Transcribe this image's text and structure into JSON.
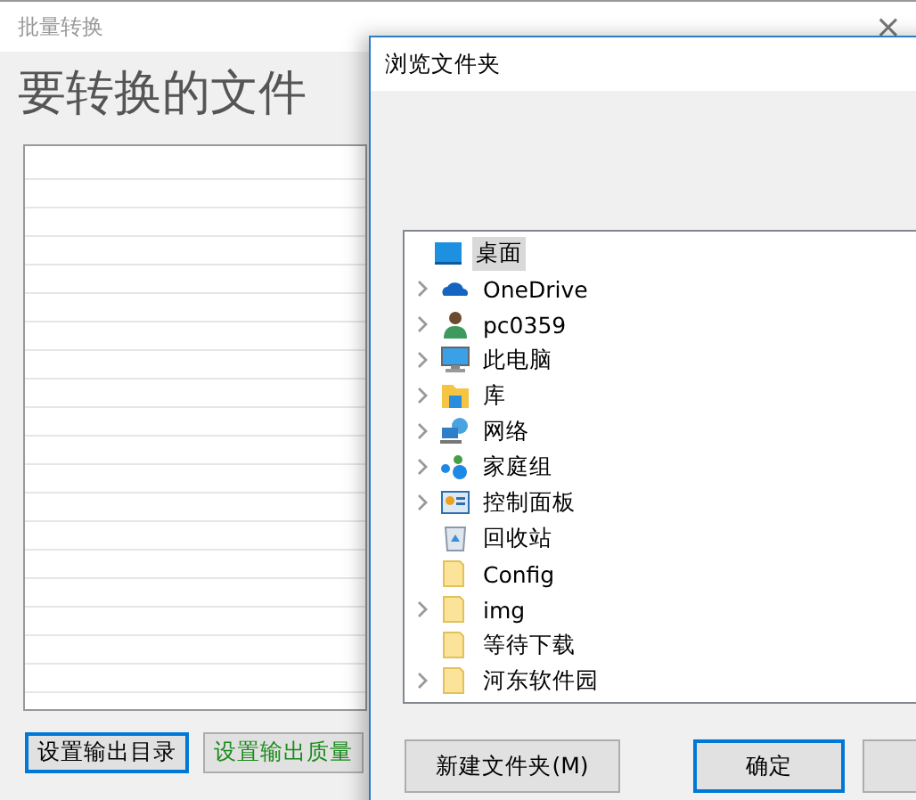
{
  "main_window": {
    "title": "批量转换",
    "close": "×",
    "heading": "要转换的文件",
    "buttons": [
      {
        "label": "设置输出目录",
        "focused": true,
        "color": "#000000"
      },
      {
        "label": "设置输出质量",
        "focused": false,
        "color": "#1a8a1a"
      }
    ]
  },
  "dialog": {
    "title": "浏览文件夹",
    "tree": [
      {
        "label": "桌面",
        "kind": "desktop",
        "selected": true,
        "expandable": false,
        "children": [
          {
            "label": "OneDrive",
            "kind": "cloud",
            "selected": false,
            "expandable": true
          },
          {
            "label": "pc0359",
            "kind": "user",
            "selected": false,
            "expandable": true
          },
          {
            "label": "此电脑",
            "kind": "monitor",
            "selected": false,
            "expandable": true
          },
          {
            "label": "库",
            "kind": "library",
            "selected": false,
            "expandable": true
          },
          {
            "label": "网络",
            "kind": "network",
            "selected": false,
            "expandable": true
          },
          {
            "label": "家庭组",
            "kind": "homegroup",
            "selected": false,
            "expandable": true
          },
          {
            "label": "控制面板",
            "kind": "control",
            "selected": false,
            "expandable": true
          },
          {
            "label": "回收站",
            "kind": "bin",
            "selected": false,
            "expandable": false
          },
          {
            "label": "Config",
            "kind": "folder",
            "selected": false,
            "expandable": false
          },
          {
            "label": "img",
            "kind": "folder",
            "selected": false,
            "expandable": true
          },
          {
            "label": "等待下载",
            "kind": "folder",
            "selected": false,
            "expandable": false
          },
          {
            "label": "河东软件园",
            "kind": "folder",
            "selected": false,
            "expandable": true
          }
        ]
      }
    ],
    "buttons": [
      {
        "label": "新建文件夹(M)",
        "default": false
      },
      {
        "label": "确定",
        "default": true
      },
      {
        "default": false
      }
    ]
  }
}
